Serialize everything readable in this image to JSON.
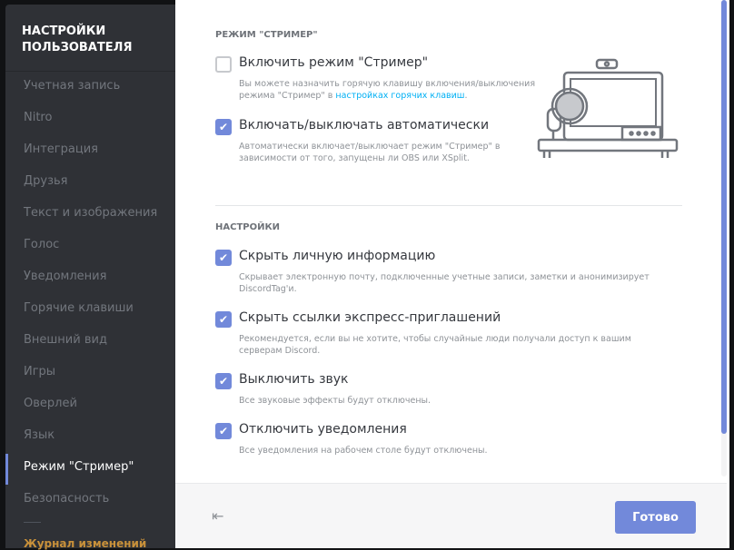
{
  "sidebar": {
    "title_line1": "НАСТРОЙКИ",
    "title_line2": "ПОЛЬЗОВАТЕЛЯ",
    "items": [
      "Учетная запись",
      "Nitro",
      "Интеграция",
      "Друзья",
      "Текст и изображения",
      "Голос",
      "Уведомления",
      "Горячие клавиши",
      "Внешний вид",
      "Игры",
      "Оверлей",
      "Язык",
      "Режим \"Стример\"",
      "Безопасность"
    ],
    "selected": "Режим \"Стример\"",
    "changelog": "Журнал изменений"
  },
  "streamer": {
    "heading": "РЕЖИМ \"СТРИМЕР\"",
    "enable": {
      "label": "Включить режим \"Стример\"",
      "checked": false,
      "desc": "Вы можете назначить горячую клавишу включения/выключения режима \"Стример\" в ",
      "link": "настройках горячих клавиш",
      "desc_end": "."
    },
    "auto": {
      "label": "Включать/выключать автоматически",
      "checked": true,
      "desc": "Автоматически включает/выключает режим \"Стример\" в зависимости от того, запущены ли OBS или XSplit."
    }
  },
  "settings": {
    "heading": "НАСТРОЙКИ",
    "options": [
      {
        "label": "Скрыть личную информацию",
        "checked": true,
        "desc": "Скрывает электронную почту, подключенные учетные записи, заметки и анонимизирует DiscordTag'и."
      },
      {
        "label": "Скрыть ссылки экспресс-приглашений",
        "checked": true,
        "desc": "Рекомендуется, если вы не хотите, чтобы случайные люди получали доступ к вашим серверам Discord."
      },
      {
        "label": "Выключить звук",
        "checked": true,
        "desc": "Все звуковые эффекты будут отключены."
      },
      {
        "label": "Отключить уведомления",
        "checked": true,
        "desc": "Все уведомления на рабочем столе будут отключены."
      }
    ]
  },
  "footer": {
    "done": "Готово",
    "back_icon": "logout-icon"
  },
  "colors": {
    "accent": "#7289da",
    "sidebar": "#2f3136",
    "link": "#00b0f4",
    "changelog": "#c9913a"
  }
}
